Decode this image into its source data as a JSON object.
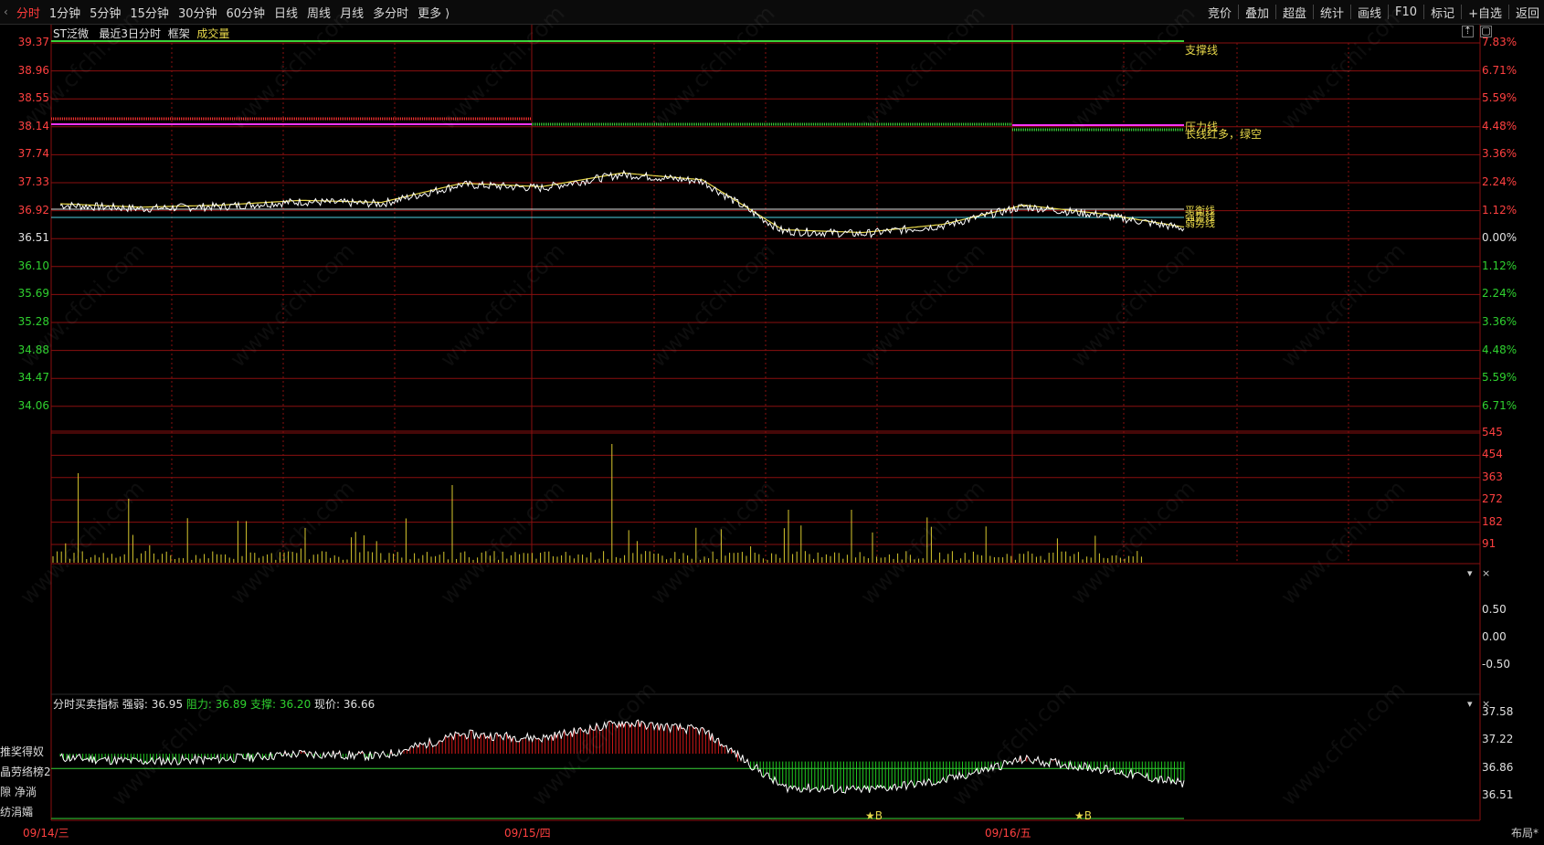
{
  "toolbar": {
    "left": [
      {
        "label": "分时",
        "active": true
      },
      {
        "label": "1分钟"
      },
      {
        "label": "5分钟"
      },
      {
        "label": "15分钟"
      },
      {
        "label": "30分钟"
      },
      {
        "label": "60分钟"
      },
      {
        "label": "日线"
      },
      {
        "label": "周线"
      },
      {
        "label": "月线"
      },
      {
        "label": "多分时"
      },
      {
        "label": "更多 ⟩"
      }
    ],
    "right": [
      {
        "label": "竞价"
      },
      {
        "label": "叠加"
      },
      {
        "label": "超盘"
      },
      {
        "label": "统计"
      },
      {
        "label": "画线"
      },
      {
        "label": "F10"
      },
      {
        "label": "标记"
      },
      {
        "label": "+自选"
      },
      {
        "label": "返回"
      }
    ]
  },
  "main_panel": {
    "stock": "ST泛微",
    "range": "最近3日分时",
    "frame": "框架",
    "volume_label": "成交量",
    "annotations": {
      "support": "支撑线",
      "pressure": "压力线",
      "long_short": "长线红多，绿空",
      "balance": "平衡线",
      "strong": "强势线",
      "weak": "弱势线"
    },
    "price_ticks": [
      "39.37",
      "38.96",
      "38.55",
      "38.14",
      "37.74",
      "37.33",
      "36.92",
      "36.51",
      "36.10",
      "35.69",
      "35.28",
      "34.88",
      "34.47",
      "34.06"
    ],
    "pct_ticks": [
      "7.83%",
      "6.71%",
      "5.59%",
      "4.48%",
      "3.36%",
      "2.24%",
      "1.12%",
      "0.00%",
      "1.12%",
      "2.24%",
      "3.36%",
      "4.48%",
      "5.59%",
      "6.71%"
    ],
    "volume_ticks": [
      "545",
      "454",
      "363",
      "272",
      "182",
      "91"
    ]
  },
  "panel2": {
    "ticks": [
      "0.50",
      "0.00",
      "-0.50"
    ]
  },
  "panel3": {
    "title": "分时买卖指标",
    "strength_label": "强弱:",
    "strength_value": "36.95",
    "resist_label": "阻力:",
    "resist_value": "36.89",
    "support_label": "支撑:",
    "support_value": "36.20",
    "price_label": "现价:",
    "price_value": "36.66",
    "ticks": [
      "37.58",
      "37.22",
      "36.86",
      "36.51"
    ],
    "markers": [
      "B",
      "B"
    ]
  },
  "side_labels": [
    "推奖得奴",
    "晶劳络榜2",
    "隙 净淌",
    "纺涓孀"
  ],
  "x_labels": [
    "09/14/三",
    "09/15/四",
    "09/16/五"
  ],
  "layout_btn": "布局*",
  "watermark": "www.cfchi.com",
  "chart_data": {
    "type": "line",
    "x": [
      "09/14/三",
      "09/15/四",
      "09/16/五"
    ],
    "series": [
      {
        "values": [
          37.0,
          36.95,
          36.98,
          37.05,
          37.02,
          37.3,
          37.25,
          37.45,
          37.35,
          36.62,
          36.58,
          36.7,
          36.98,
          36.85,
          36.66
        ]
      }
    ],
    "colors": {
      "price": "#ffffff",
      "avg": "#e8d84a",
      "grid": "#8a0f0f",
      "pressure": "#ff33ff",
      "support": "#39d339",
      "volume": "#d8c82e"
    }
  }
}
